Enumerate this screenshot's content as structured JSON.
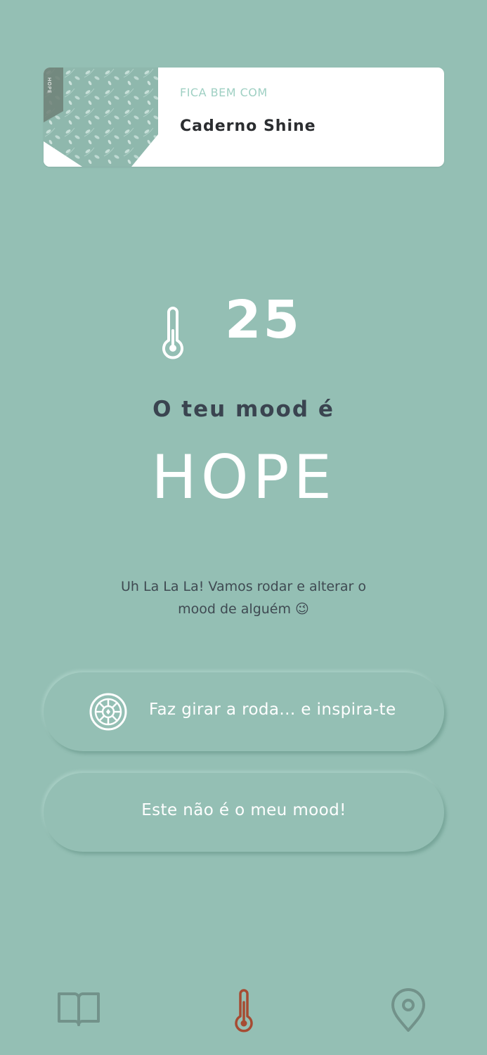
{
  "colors": {
    "background": "#94bfb4",
    "accent_active": "#a64b32",
    "nav_inactive": "#72928a",
    "eyebrow": "#9fd0c3"
  },
  "product_card": {
    "eyebrow": "FICA BEM COM",
    "name": "Caderno Shine",
    "image_text": "HOPE"
  },
  "mood": {
    "temperature": "25",
    "intro": "O teu mood é",
    "name": "HOPE",
    "message": "Uh La La La! Vamos rodar e alterar o mood de alguém 😉"
  },
  "actions": {
    "spin_label": "Faz girar a roda... e inspira-te",
    "not_my_mood_label": "Este não é o meu mood!"
  },
  "nav": {
    "items": [
      {
        "icon": "book-icon",
        "active": false
      },
      {
        "icon": "thermometer-icon",
        "active": true
      },
      {
        "icon": "location-pin-icon",
        "active": false
      }
    ]
  }
}
